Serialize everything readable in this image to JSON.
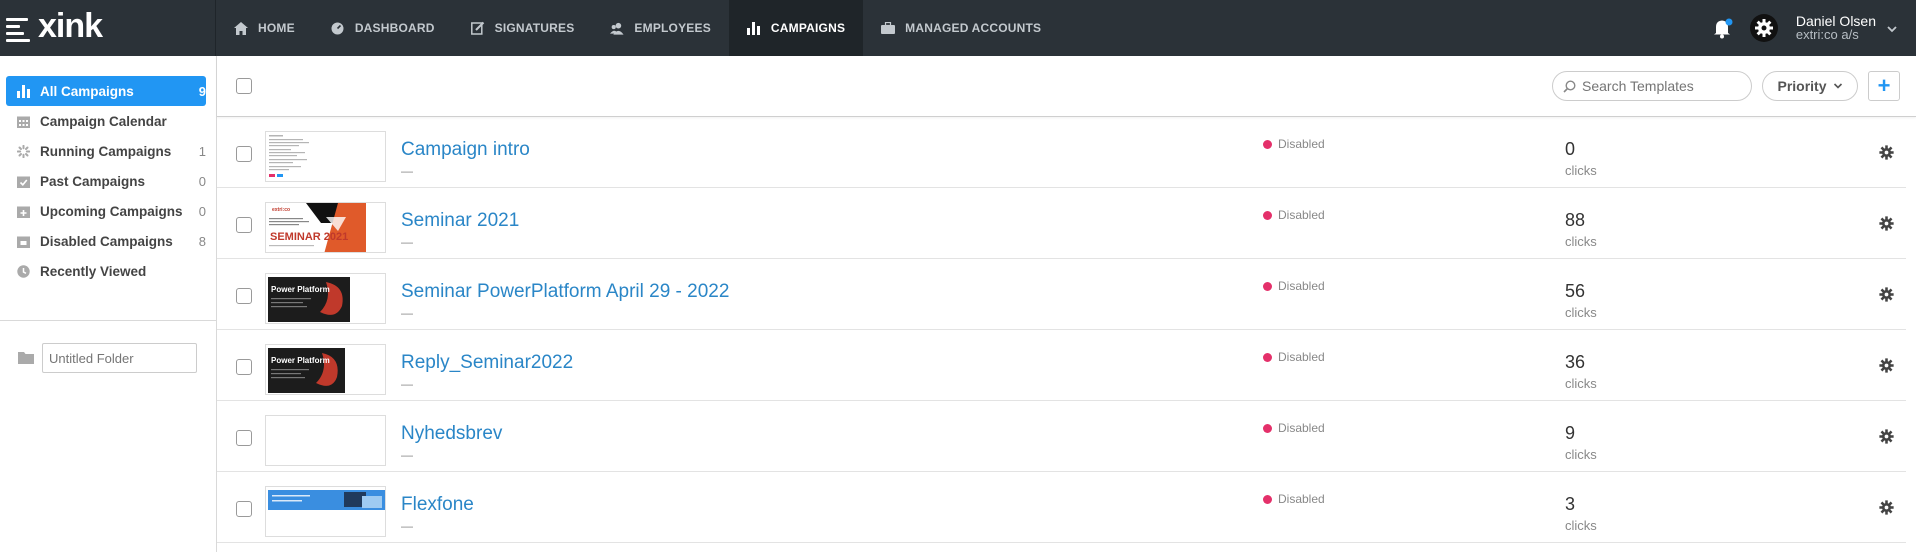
{
  "app": {
    "logo": "xink"
  },
  "nav": [
    {
      "label": "HOME",
      "icon": "home-icon"
    },
    {
      "label": "DASHBOARD",
      "icon": "gauge-icon"
    },
    {
      "label": "SIGNATURES",
      "icon": "edit-icon"
    },
    {
      "label": "EMPLOYEES",
      "icon": "users-icon"
    },
    {
      "label": "CAMPAIGNS",
      "icon": "bar-chart-icon",
      "active": true
    },
    {
      "label": "MANAGED ACCOUNTS",
      "icon": "briefcase-icon"
    }
  ],
  "user": {
    "name": "Daniel Olsen",
    "company": "extri:co a/s"
  },
  "sidebar": {
    "items": [
      {
        "label": "All Campaigns",
        "count": "9",
        "icon": "bar-chart-icon",
        "active": true
      },
      {
        "label": "Campaign Calendar",
        "count": "",
        "icon": "calendar-icon"
      },
      {
        "label": "Running Campaigns",
        "count": "1",
        "icon": "spinner-icon"
      },
      {
        "label": "Past Campaigns",
        "count": "0",
        "icon": "calendar-check-icon"
      },
      {
        "label": "Upcoming Campaigns",
        "count": "0",
        "icon": "calendar-plus-icon"
      },
      {
        "label": "Disabled Campaigns",
        "count": "8",
        "icon": "calendar-x-icon"
      },
      {
        "label": "Recently Viewed",
        "count": "",
        "icon": "clock-icon"
      }
    ],
    "folder": {
      "placeholder": "Untitled Folder"
    }
  },
  "toolbar": {
    "search_placeholder": "Search Templates",
    "sort_label": "Priority",
    "add_label": "+"
  },
  "campaigns": [
    {
      "title": "Campaign intro",
      "subtitle": "—",
      "status": "Disabled",
      "clicks": "0",
      "clicks_label": "clicks",
      "thumb": "doc"
    },
    {
      "title": "Seminar 2021",
      "subtitle": "—",
      "status": "Disabled",
      "clicks": "88",
      "clicks_label": "clicks",
      "thumb": "seminar",
      "thumb_text": "SEMINAR 2021",
      "thumb_brand": "extri:co"
    },
    {
      "title": "Seminar PowerPlatform April 29 - 2022",
      "subtitle": "—",
      "status": "Disabled",
      "clicks": "56",
      "clicks_label": "clicks",
      "thumb": "power",
      "thumb_text": "Power Platform"
    },
    {
      "title": "Reply_Seminar2022",
      "subtitle": "—",
      "status": "Disabled",
      "clicks": "36",
      "clicks_label": "clicks",
      "thumb": "power",
      "thumb_text": "Power Platform"
    },
    {
      "title": "Nyhedsbrev",
      "subtitle": "—",
      "status": "Disabled",
      "clicks": "9",
      "clicks_label": "clicks",
      "thumb": "blank"
    },
    {
      "title": "Flexfone",
      "subtitle": "—",
      "status": "Disabled",
      "clicks": "3",
      "clicks_label": "clicks",
      "thumb": "flex"
    }
  ],
  "colors": {
    "accent": "#2196f3",
    "topbar": "#2b3238",
    "disabled_dot": "#e4306a",
    "link": "#2a86c7"
  }
}
